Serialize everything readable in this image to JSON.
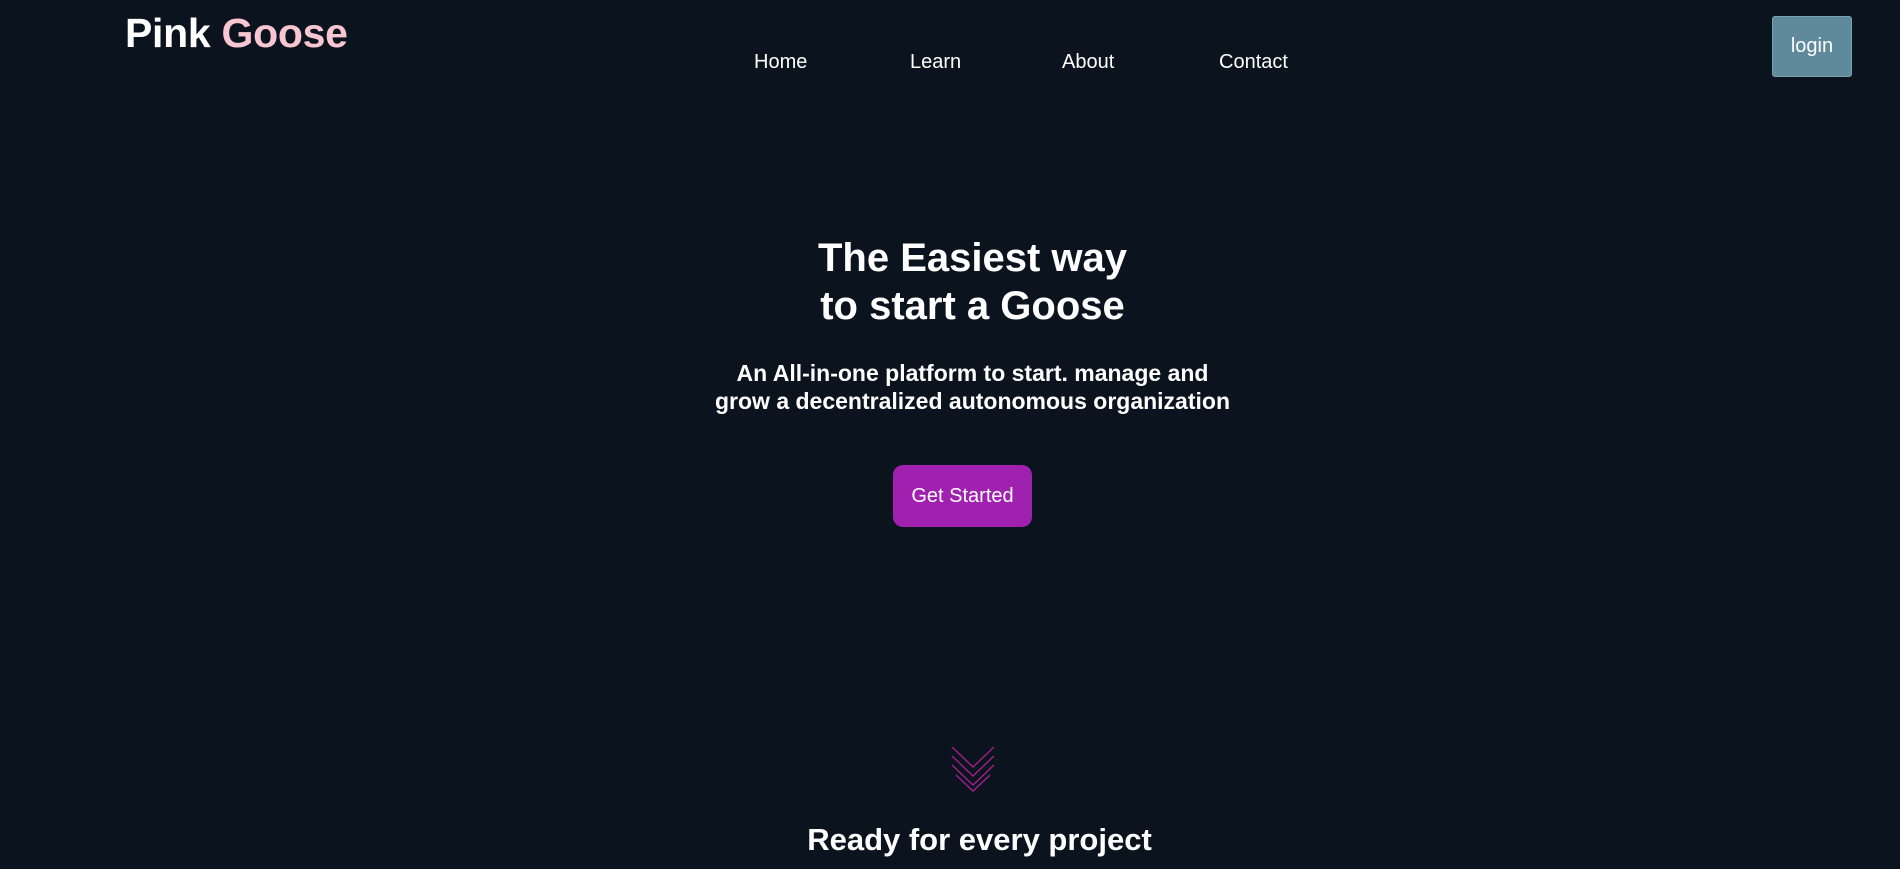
{
  "logo": {
    "word1": "Pink",
    "word2": "Goose"
  },
  "nav": {
    "items": [
      {
        "label": "Home"
      },
      {
        "label": "Learn"
      },
      {
        "label": "About"
      },
      {
        "label": "Contact"
      }
    ],
    "login_label": "login"
  },
  "hero": {
    "title_line1": "The Easiest way",
    "title_line2": "to start a Goose",
    "subtitle_line1": "An All-in-one platform to start. manage and",
    "subtitle_line2": "grow a decentralized autonomous organization",
    "cta_label": "Get Started"
  },
  "scroll_indicator": {
    "icon": "chevron-down-icon",
    "color": "#a0208a"
  },
  "section": {
    "title": "Ready for every project"
  },
  "colors": {
    "background": "#0b131f",
    "logo_accent": "#f7c6d0",
    "login_button": "#5e8a9c",
    "cta_button": "#a020b0"
  }
}
